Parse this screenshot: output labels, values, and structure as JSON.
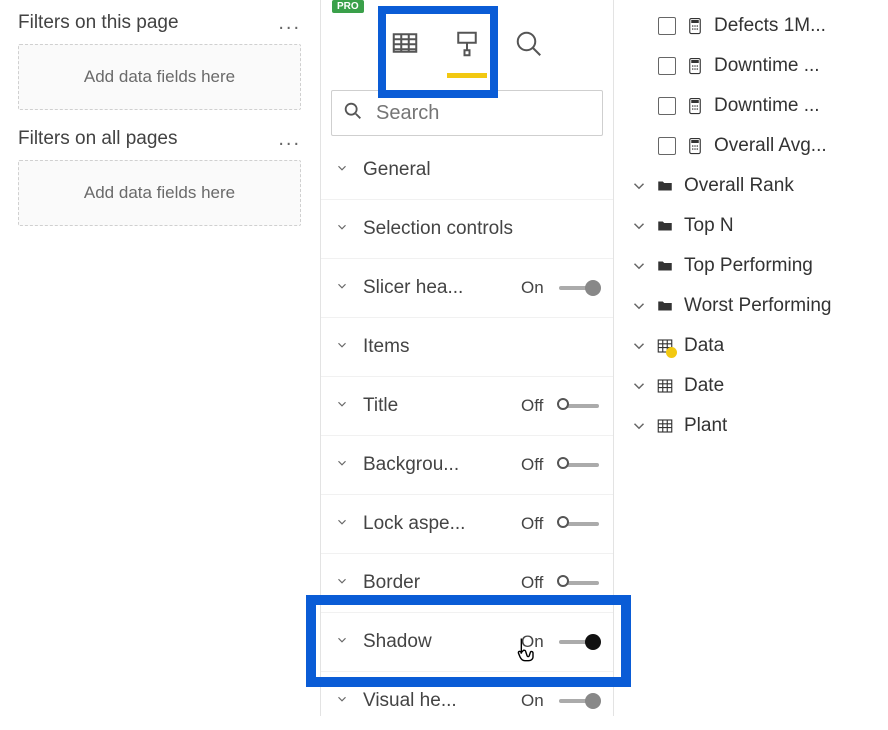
{
  "filters": {
    "pageTitle": "Filters on this page",
    "allPagesTitle": "Filters on all pages",
    "dropHint": "Add data fields here"
  },
  "format": {
    "searchPlaceholder": "Search",
    "badge": "PRO",
    "items": [
      {
        "label": "General",
        "toggle": null
      },
      {
        "label": "Selection controls",
        "toggle": null
      },
      {
        "label": "Slicer hea...",
        "toggle": "On",
        "knob": "grey"
      },
      {
        "label": "Items",
        "toggle": null
      },
      {
        "label": "Title",
        "toggle": "Off"
      },
      {
        "label": "Backgrou...",
        "toggle": "Off"
      },
      {
        "label": "Lock aspe...",
        "toggle": "Off"
      },
      {
        "label": "Border",
        "toggle": "Off"
      },
      {
        "label": "Shadow",
        "toggle": "On",
        "knob": "dark"
      },
      {
        "label": "Visual he...",
        "toggle": "On",
        "knob": "grey"
      }
    ]
  },
  "fields": {
    "measures": [
      "Defects 1M...",
      "Downtime ...",
      "Downtime ...",
      "Overall Avg..."
    ],
    "folders": [
      "Overall Rank",
      "Top N",
      "Top Performing",
      "Worst Performing"
    ],
    "tables": [
      {
        "label": "Data",
        "highlighted": true
      },
      {
        "label": "Date",
        "highlighted": false
      },
      {
        "label": "Plant",
        "highlighted": false
      }
    ]
  }
}
